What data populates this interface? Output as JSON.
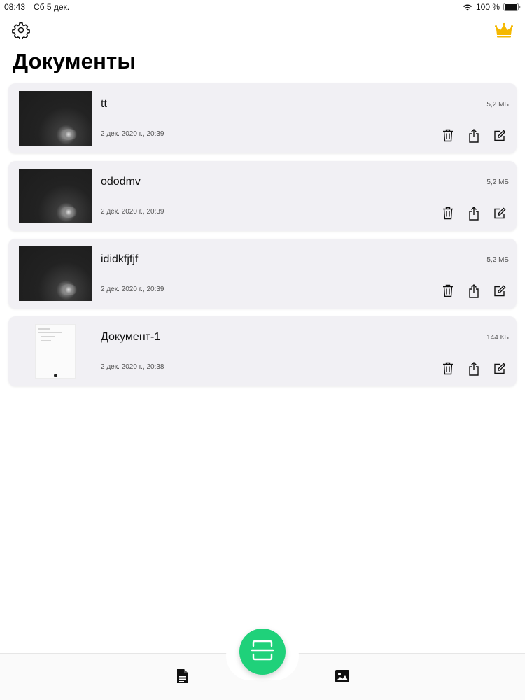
{
  "status_bar": {
    "time": "08:43",
    "date": "Сб 5 дек.",
    "battery": "100 %"
  },
  "header": {
    "title": "Документы",
    "settings_icon": "gear-icon",
    "premium_icon": "crown-icon",
    "premium_color": "#f5b800"
  },
  "documents": [
    {
      "name": "tt",
      "size": "5,2 МБ",
      "date": "2 дек. 2020 г., 20:39",
      "thumbnail": "dark-photo"
    },
    {
      "name": "ododmv",
      "size": "5,2 МБ",
      "date": "2 дек. 2020 г., 20:39",
      "thumbnail": "dark-photo"
    },
    {
      "name": "ididkfjfjf",
      "size": "5,2 МБ",
      "date": "2 дек. 2020 г., 20:39",
      "thumbnail": "dark-photo"
    },
    {
      "name": "Документ-1",
      "size": "144 КБ",
      "date": "2 дек. 2020 г., 20:38",
      "thumbnail": "document-page"
    }
  ],
  "actions": [
    "trash-icon",
    "share-icon",
    "edit-icon"
  ],
  "tab_bar": {
    "left_tab_icon": "document-icon",
    "right_tab_icon": "gallery-icon",
    "scan_button_icon": "scan-icon",
    "scan_color": "#1fd17a"
  }
}
